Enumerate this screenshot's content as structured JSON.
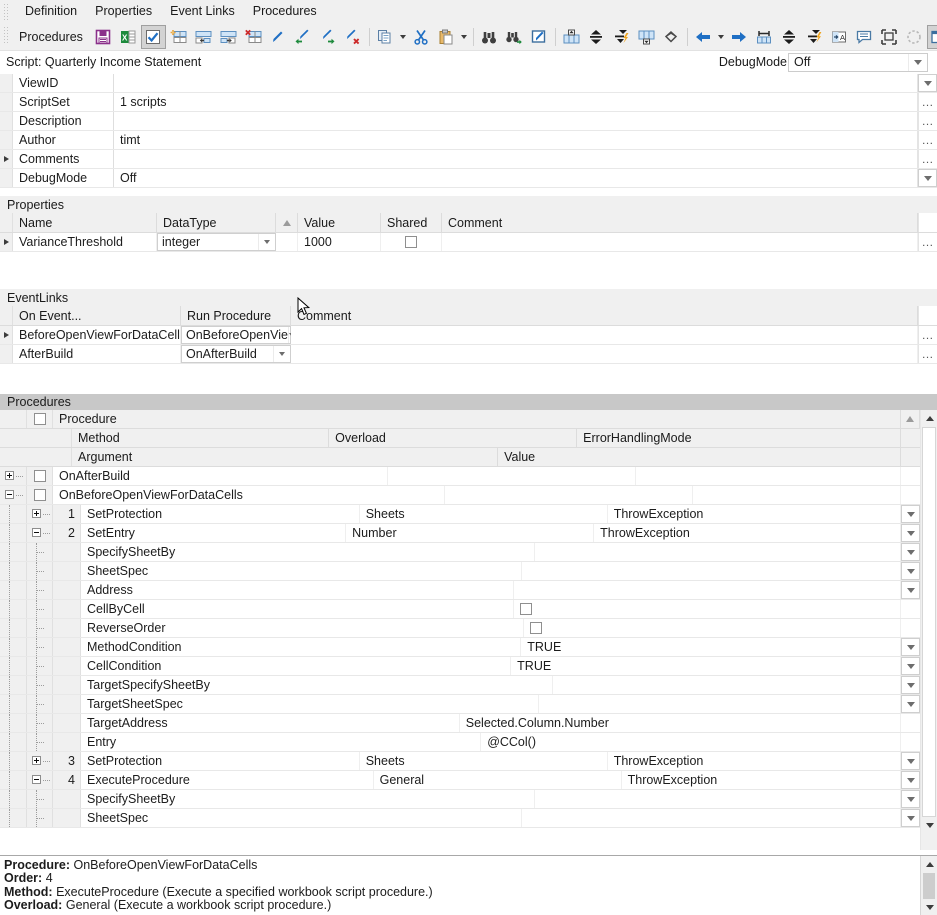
{
  "menubar": {
    "items": [
      {
        "label": "Definition"
      },
      {
        "label": "Properties"
      },
      {
        "label": "Event Links"
      },
      {
        "label": "Procedures"
      }
    ]
  },
  "toolbar": {
    "label": "Procedures",
    "buttons": [
      {
        "name": "save-icon",
        "glyph": "save"
      },
      {
        "name": "export-excel-icon",
        "glyph": "excel"
      },
      {
        "name": "validate-check-icon",
        "glyph": "check",
        "pressed": true
      },
      {
        "name": "insert-row-icon",
        "glyph": "insert-row"
      },
      {
        "name": "insert-left-icon",
        "glyph": "insert-left"
      },
      {
        "name": "insert-right-icon",
        "glyph": "insert-right"
      },
      {
        "name": "delete-row-icon",
        "glyph": "delete-row"
      },
      {
        "name": "edit-pen-icon",
        "glyph": "pen"
      },
      {
        "name": "pen-prev-icon",
        "glyph": "pen-left"
      },
      {
        "name": "pen-next-icon",
        "glyph": "pen-right"
      },
      {
        "name": "pen-delete-icon",
        "glyph": "pen-x"
      },
      {
        "name": "copy-icon",
        "glyph": "copy",
        "caret": true
      },
      {
        "name": "cut-icon",
        "glyph": "cut"
      },
      {
        "name": "paste-icon",
        "glyph": "paste",
        "caret": true
      },
      {
        "name": "find-icon",
        "glyph": "binoculars"
      },
      {
        "name": "find-next-icon",
        "glyph": "binoculars-go"
      },
      {
        "name": "edit-note-icon",
        "glyph": "note-pen"
      },
      {
        "name": "move-up-top-icon",
        "glyph": "up-top"
      },
      {
        "name": "move-up-icon",
        "glyph": "up"
      },
      {
        "name": "move-down-icon",
        "glyph": "down"
      },
      {
        "name": "move-down-bottom-icon",
        "glyph": "down-bottom"
      },
      {
        "name": "diamond-icon",
        "glyph": "diamond"
      },
      {
        "name": "back-icon",
        "glyph": "arrow-left",
        "caret": true
      },
      {
        "name": "forward-icon",
        "glyph": "arrow-right"
      },
      {
        "name": "measure-icon",
        "glyph": "measure"
      },
      {
        "name": "collapse-icon",
        "glyph": "collapse"
      },
      {
        "name": "collapse-fast-icon",
        "glyph": "collapse-fast"
      },
      {
        "name": "rename-icon",
        "glyph": "rename"
      },
      {
        "name": "comment-icon",
        "glyph": "comment"
      },
      {
        "name": "select-frame-icon",
        "glyph": "frame"
      },
      {
        "name": "circle-dashed-icon",
        "glyph": "circle-dashed"
      },
      {
        "name": "help-window-icon",
        "glyph": "help-window",
        "pressed": true
      },
      {
        "name": "overflow-up-icon",
        "glyph": "chevron-up"
      }
    ]
  },
  "script": {
    "title": "Script: Quarterly Income Statement",
    "debug_mode_label": "DebugMode",
    "debug_mode_value": "Off"
  },
  "definition": {
    "rows": [
      {
        "name": "ViewID",
        "value": "",
        "end": "arrow",
        "marker": false
      },
      {
        "name": "ScriptSet",
        "value": "1 scripts",
        "end": "ellipsis",
        "marker": false
      },
      {
        "name": "Description",
        "value": "",
        "end": "ellipsis",
        "marker": false
      },
      {
        "name": "Author",
        "value": "timt",
        "end": "ellipsis",
        "marker": false
      },
      {
        "name": "Comments",
        "value": "",
        "end": "ellipsis",
        "marker": true
      },
      {
        "name": "DebugMode",
        "value": "Off",
        "end": "arrow",
        "marker": false
      }
    ]
  },
  "properties": {
    "section_title": "Properties",
    "columns": [
      "Name",
      "DataType",
      "Value",
      "Shared",
      "Comment"
    ],
    "rows": [
      {
        "marker": true,
        "name": "VarianceThreshold",
        "datatype": "integer",
        "value": "1000",
        "shared": false,
        "comment": "",
        "end": "ellipsis"
      }
    ]
  },
  "eventlinks": {
    "section_title": "EventLinks",
    "columns": [
      "On Event...",
      "Run Procedure",
      "Comment"
    ],
    "rows": [
      {
        "marker": true,
        "on_event": "BeforeOpenViewForDataCells",
        "run_procedure": "OnBeforeOpenVie",
        "comment": "",
        "end": "ellipsis"
      },
      {
        "marker": false,
        "on_event": "AfterBuild",
        "run_procedure": "OnAfterBuild",
        "comment": "",
        "end": "ellipsis"
      }
    ]
  },
  "procedures": {
    "section_title": "Procedures",
    "group_header": "Procedure",
    "columns_level1": [
      "Method",
      "Overload",
      "ErrorHandlingMode"
    ],
    "columns_level2": [
      "Argument",
      "Value"
    ],
    "rows": [
      {
        "kind": "proc",
        "indent": 0,
        "expander": "plus",
        "checkbox": true,
        "num": "",
        "label": "OnAfterBuild",
        "overload": "",
        "ehm": "",
        "dropdown": false
      },
      {
        "kind": "proc",
        "indent": 0,
        "expander": "minus",
        "checkbox": true,
        "num": "",
        "label": "OnBeforeOpenViewForDataCells",
        "overload": "",
        "ehm": "",
        "dropdown": false
      },
      {
        "kind": "method",
        "indent": 1,
        "expander": "plus",
        "num": "1",
        "label": "SetProtection",
        "overload": "Sheets",
        "ehm": "ThrowException",
        "dropdown": true
      },
      {
        "kind": "method",
        "indent": 1,
        "expander": "minus",
        "num": "2",
        "label": "SetEntry",
        "overload": "Number",
        "ehm": "ThrowException",
        "dropdown": true
      },
      {
        "kind": "arg",
        "indent": 2,
        "label": "SpecifySheetBy",
        "value": "",
        "dropdown": true,
        "checkbox": false
      },
      {
        "kind": "arg",
        "indent": 2,
        "label": "SheetSpec",
        "value": "",
        "dropdown": true,
        "checkbox": false
      },
      {
        "kind": "arg",
        "indent": 2,
        "label": "Address",
        "value": "",
        "dropdown": true,
        "checkbox": false
      },
      {
        "kind": "arg",
        "indent": 2,
        "label": "CellByCell",
        "value": "",
        "dropdown": false,
        "checkbox": true
      },
      {
        "kind": "arg",
        "indent": 2,
        "label": "ReverseOrder",
        "value": "",
        "dropdown": false,
        "checkbox": true
      },
      {
        "kind": "arg",
        "indent": 2,
        "label": "MethodCondition",
        "value": "TRUE",
        "dropdown": true,
        "checkbox": false
      },
      {
        "kind": "arg",
        "indent": 2,
        "label": "CellCondition",
        "value": "TRUE",
        "dropdown": true,
        "checkbox": false
      },
      {
        "kind": "arg",
        "indent": 2,
        "label": "TargetSpecifySheetBy",
        "value": "",
        "dropdown": true,
        "checkbox": false
      },
      {
        "kind": "arg",
        "indent": 2,
        "label": "TargetSheetSpec",
        "value": "",
        "dropdown": true,
        "checkbox": false
      },
      {
        "kind": "arg",
        "indent": 2,
        "label": "TargetAddress",
        "value": "Selected.Column.Number",
        "dropdown": false,
        "checkbox": false
      },
      {
        "kind": "arg",
        "indent": 2,
        "label": "Entry",
        "value": "@CCol()",
        "dropdown": false,
        "checkbox": false
      },
      {
        "kind": "method",
        "indent": 1,
        "expander": "plus",
        "num": "3",
        "label": "SetProtection",
        "overload": "Sheets",
        "ehm": "ThrowException",
        "dropdown": true
      },
      {
        "kind": "method",
        "indent": 1,
        "expander": "minus",
        "num": "4",
        "label": "ExecuteProcedure",
        "overload": "General",
        "ehm": "ThrowException",
        "dropdown": true
      },
      {
        "kind": "arg",
        "indent": 2,
        "label": "SpecifySheetBy",
        "value": "",
        "dropdown": true,
        "checkbox": false
      },
      {
        "kind": "arg",
        "indent": 2,
        "label": "SheetSpec",
        "value": "",
        "dropdown": true,
        "checkbox": false
      }
    ]
  },
  "info": {
    "lines": [
      {
        "label": "Procedure:",
        "text": "OnBeforeOpenViewForDataCells"
      },
      {
        "label": "Order:",
        "text": "4"
      },
      {
        "label": "Method:",
        "text": "ExecuteProcedure (Execute a specified workbook script procedure.)"
      },
      {
        "label": "Overload:",
        "text": "General (Execute a workbook script procedure.)"
      }
    ]
  },
  "colors": {
    "toolbar_bg": "#f0f0f0",
    "section_bar": "#f0f0f0",
    "procedures_bar": "#c8c8c8",
    "accent_blue": "#1f6fc4",
    "accent_green": "#1d8a3c",
    "accent_purple": "#8a2f8a",
    "accent_red": "#cc2a2a",
    "grid_line": "#e8e8e8"
  }
}
